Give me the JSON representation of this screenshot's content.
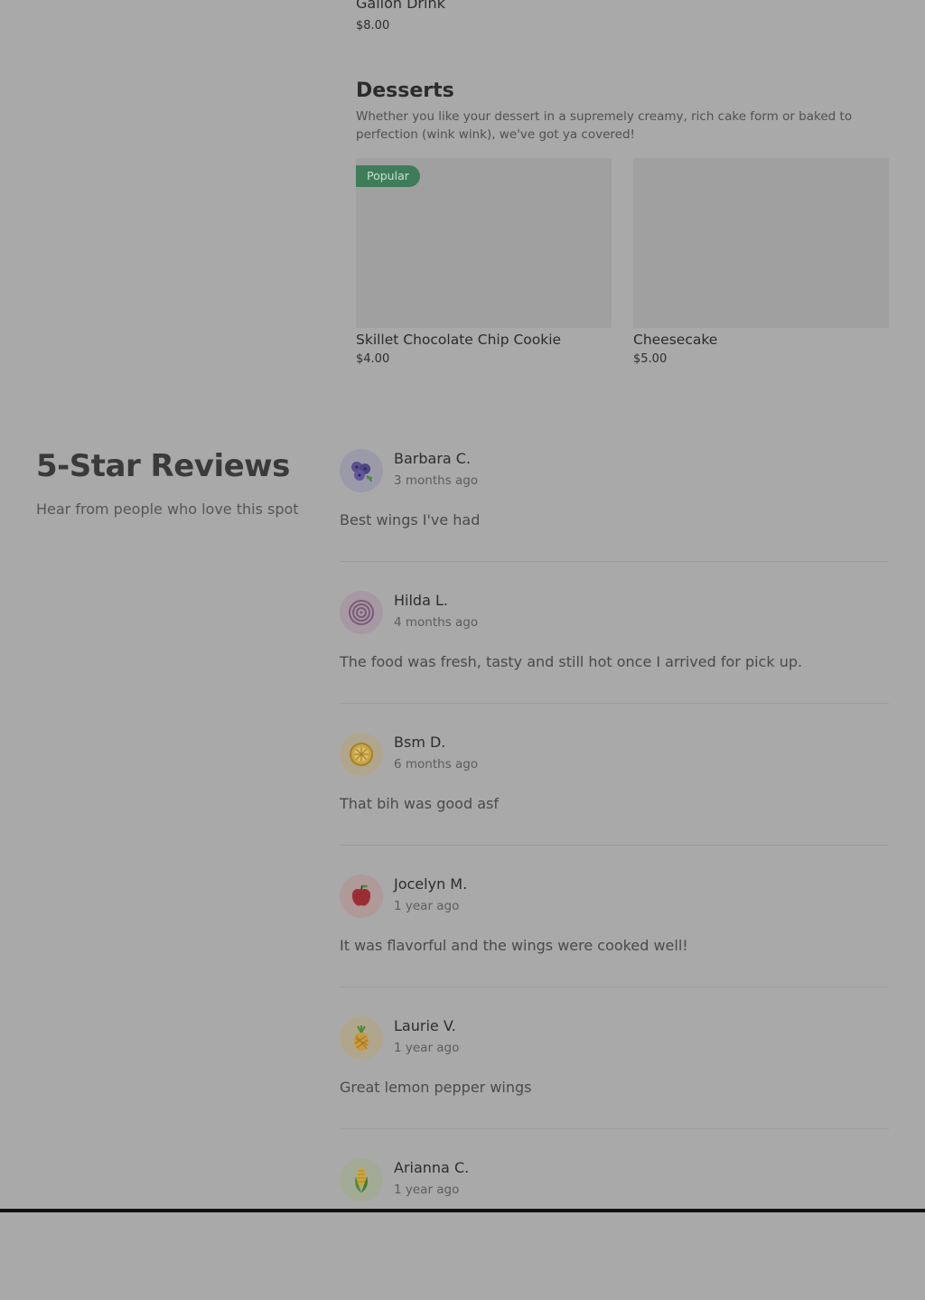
{
  "menu": {
    "previous_item": {
      "name": "Gallon Drink",
      "price": "$8.00"
    },
    "category": {
      "title": "Desserts",
      "description": "Whether you like your dessert in a supremely creamy, rich cake form or baked to perfection (wink wink), we've got ya covered!"
    },
    "items": [
      {
        "name": "Skillet Chocolate Chip Cookie",
        "price": "$4.00",
        "badge": "Popular"
      },
      {
        "name": "Cheesecake",
        "price": "$5.00"
      }
    ]
  },
  "reviews": {
    "title": "5-Star Reviews",
    "subtitle": "Hear from people who love this spot",
    "items": [
      {
        "name": "Barbara C.",
        "date": "3 months ago",
        "text": "Best wings I've had",
        "avatar_icon": "blueberry-icon",
        "avatar_bg": "#9b9aa9"
      },
      {
        "name": "Hilda L.",
        "date": "4 months ago",
        "text": "The food was fresh, tasty and still hot once I arrived for pick up.",
        "avatar_icon": "onion-icon",
        "avatar_bg": "#a799a3"
      },
      {
        "name": "Bsm D.",
        "date": "6 months ago",
        "text": "That bih was good asf",
        "avatar_icon": "lemon-icon",
        "avatar_bg": "#b0a68e"
      },
      {
        "name": "Jocelyn M.",
        "date": "1 year ago",
        "text": "It was flavorful and the wings were cooked well!",
        "avatar_icon": "apple-icon",
        "avatar_bg": "#af9999"
      },
      {
        "name": "Laurie V.",
        "date": "1 year ago",
        "text": "Great lemon pepper wings",
        "avatar_icon": "pineapple-icon",
        "avatar_bg": "#b0a68e"
      },
      {
        "name": "Arianna C.",
        "date": "1 year ago",
        "text": "",
        "avatar_icon": "corn-icon",
        "avatar_bg": "#a3aa95"
      }
    ]
  },
  "colors": {
    "page_background": "#a9a9a9",
    "badge_background": "#3f7d5a",
    "image_placeholder": "#a0a0a0"
  }
}
